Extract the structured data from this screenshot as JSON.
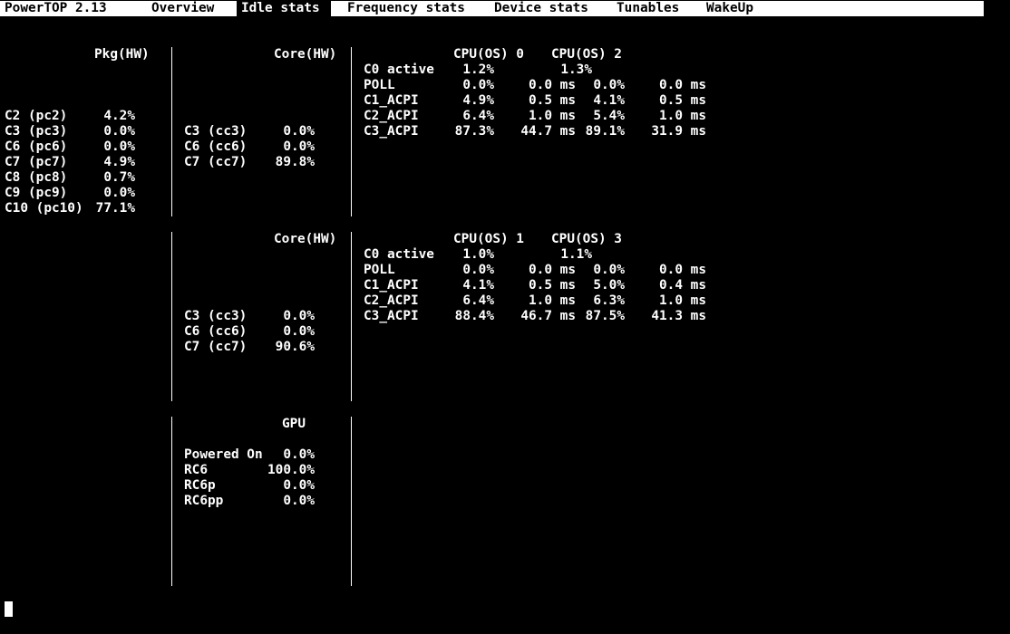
{
  "menu": {
    "app_title": "PowerTOP 2.13",
    "tabs": [
      "Overview",
      "Idle stats",
      "Frequency stats",
      "Device stats",
      "Tunables",
      "WakeUp"
    ],
    "active_tab": "Idle stats"
  },
  "pkg": {
    "header": "Pkg(HW)",
    "rows": [
      {
        "label": "C2 (pc2)",
        "value": "4.2%"
      },
      {
        "label": "C3 (pc3)",
        "value": "0.0%"
      },
      {
        "label": "C6 (pc6)",
        "value": "0.0%"
      },
      {
        "label": "C7 (pc7)",
        "value": "4.9%"
      },
      {
        "label": "C8 (pc8)",
        "value": "0.7%"
      },
      {
        "label": "C9 (pc9)",
        "value": "0.0%"
      },
      {
        "label": "C10 (pc10)",
        "value": "77.1%"
      }
    ]
  },
  "core_groups": [
    {
      "header": "Core(HW)",
      "rows": [
        {
          "label": "C3 (cc3)",
          "value": "0.0%"
        },
        {
          "label": "C6 (cc6)",
          "value": "0.0%"
        },
        {
          "label": "C7 (cc7)",
          "value": "89.8%"
        }
      ],
      "cpu_headers": [
        "CPU(OS) 0",
        "CPU(OS) 2"
      ],
      "cpu_rows": [
        {
          "state": "C0 active",
          "a_pct": "1.2%",
          "a_ms": "",
          "b_pct": "1.3%",
          "b_ms": ""
        },
        {
          "state": "POLL",
          "a_pct": "0.0%",
          "a_ms": "0.0 ms",
          "b_pct": "0.0%",
          "b_ms": "0.0 ms"
        },
        {
          "state": "C1_ACPI",
          "a_pct": "4.9%",
          "a_ms": "0.5 ms",
          "b_pct": "4.1%",
          "b_ms": "0.5 ms"
        },
        {
          "state": "C2_ACPI",
          "a_pct": "6.4%",
          "a_ms": "1.0 ms",
          "b_pct": "5.4%",
          "b_ms": "1.0 ms"
        },
        {
          "state": "C3_ACPI",
          "a_pct": "87.3%",
          "a_ms": "44.7 ms",
          "b_pct": "89.1%",
          "b_ms": "31.9 ms"
        }
      ]
    },
    {
      "header": "Core(HW)",
      "rows": [
        {
          "label": "C3 (cc3)",
          "value": "0.0%"
        },
        {
          "label": "C6 (cc6)",
          "value": "0.0%"
        },
        {
          "label": "C7 (cc7)",
          "value": "90.6%"
        }
      ],
      "cpu_headers": [
        "CPU(OS) 1",
        "CPU(OS) 3"
      ],
      "cpu_rows": [
        {
          "state": "C0 active",
          "a_pct": "1.0%",
          "a_ms": "",
          "b_pct": "1.1%",
          "b_ms": ""
        },
        {
          "state": "POLL",
          "a_pct": "0.0%",
          "a_ms": "0.0 ms",
          "b_pct": "0.0%",
          "b_ms": "0.0 ms"
        },
        {
          "state": "C1_ACPI",
          "a_pct": "4.1%",
          "a_ms": "0.5 ms",
          "b_pct": "5.0%",
          "b_ms": "0.4 ms"
        },
        {
          "state": "C2_ACPI",
          "a_pct": "6.4%",
          "a_ms": "1.0 ms",
          "b_pct": "6.3%",
          "b_ms": "1.0 ms"
        },
        {
          "state": "C3_ACPI",
          "a_pct": "88.4%",
          "a_ms": "46.7 ms",
          "b_pct": "87.5%",
          "b_ms": "41.3 ms"
        }
      ]
    }
  ],
  "gpu": {
    "header": "GPU",
    "rows": [
      {
        "label": "Powered On",
        "value": "0.0%"
      },
      {
        "label": "RC6",
        "value": "100.0%"
      },
      {
        "label": "RC6p",
        "value": "0.0%"
      },
      {
        "label": "RC6pp",
        "value": "0.0%"
      }
    ]
  }
}
